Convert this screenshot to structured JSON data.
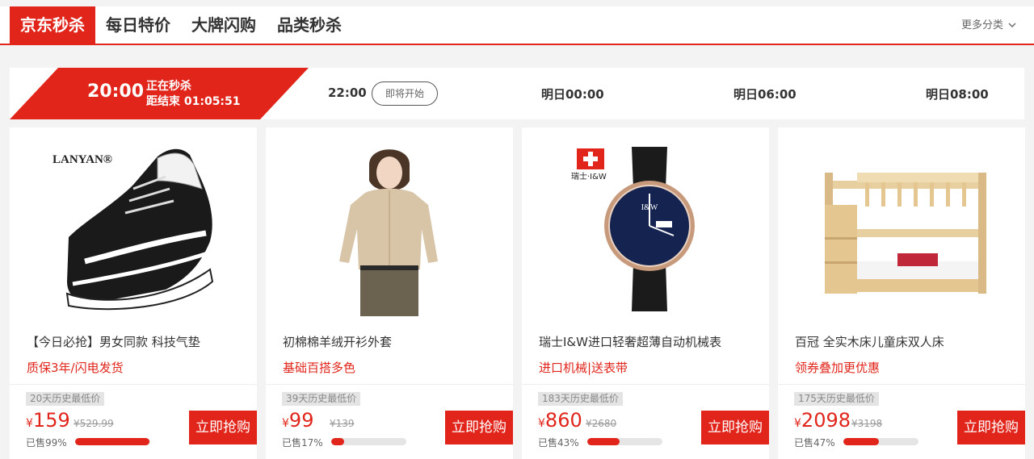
{
  "nav": {
    "tabs": [
      "京东秒杀",
      "每日特价",
      "大牌闪购",
      "品类秒杀"
    ],
    "more_label": "更多分类",
    "more_icon": "chevron-down-icon"
  },
  "timebar": {
    "current": {
      "time": "20:00",
      "status": "正在秒杀",
      "countdown": "距结束 01:05:51"
    },
    "next": {
      "time": "22:00",
      "button": "即将开始"
    },
    "slots": [
      "明日00:00",
      "明日06:00",
      "明日08:00"
    ]
  },
  "colors": {
    "accent": "#e1251b"
  },
  "products": [
    {
      "title": "【今日必抢】男女同款 科技气垫",
      "tag": "质保3年/闪电发货",
      "history": "20天历史最低价",
      "currency": "¥",
      "price": "159",
      "original": "¥529.99",
      "sold_label": "已售99%",
      "sold_fraction": 0.99,
      "buy": "立即抢购",
      "image": "sneaker-image",
      "brand": "LANYAN®"
    },
    {
      "title": "初棉棉羊绒开衫外套",
      "tag": "基础百搭多色",
      "history": "39天历史最低价",
      "currency": "¥",
      "price": "99",
      "original": "¥139",
      "sold_label": "已售17%",
      "sold_fraction": 0.17,
      "buy": "立即抢购",
      "image": "cardigan-image",
      "brand": ""
    },
    {
      "title": "瑞士I&W进口轻奢超薄自动机械表",
      "tag": "进口机械|送表带",
      "history": "183天历史最低价",
      "currency": "¥",
      "price": "860",
      "original": "¥2680",
      "sold_label": "已售43%",
      "sold_fraction": 0.43,
      "buy": "立即抢购",
      "image": "watch-image",
      "brand": "瑞士·I&W"
    },
    {
      "title": "百冠 全实木床儿童床双人床",
      "tag": "领券叠加更优惠",
      "history": "175天历史最低价",
      "currency": "¥",
      "price": "2098",
      "original": "¥3198",
      "sold_label": "已售47%",
      "sold_fraction": 0.47,
      "buy": "立即抢购",
      "image": "bunk-bed-image",
      "brand": ""
    }
  ]
}
